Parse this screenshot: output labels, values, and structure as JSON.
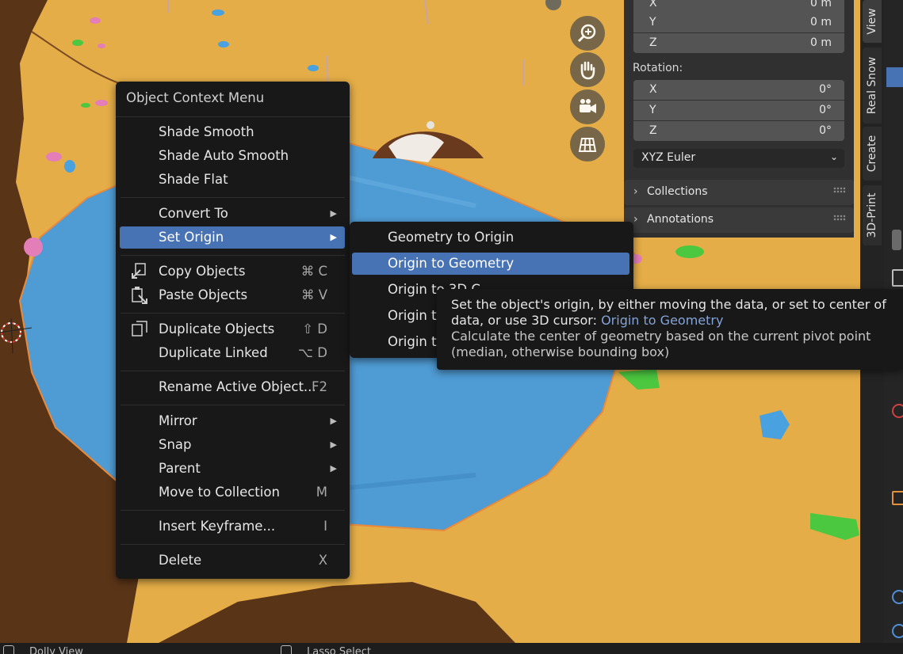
{
  "context_menu": {
    "title": "Object Context Menu",
    "items": [
      {
        "label": "Shade Smooth",
        "shortcut": ""
      },
      {
        "label": "Shade Auto Smooth",
        "shortcut": ""
      },
      {
        "label": "Shade Flat",
        "shortcut": ""
      },
      {
        "label": "Convert To",
        "shortcut": ""
      },
      {
        "label": "Set Origin",
        "shortcut": ""
      },
      {
        "label": "Copy Objects",
        "shortcut": "⌘ C"
      },
      {
        "label": "Paste Objects",
        "shortcut": "⌘ V"
      },
      {
        "label": "Duplicate Objects",
        "shortcut": "⇧ D"
      },
      {
        "label": "Duplicate Linked",
        "shortcut": "⌥ D"
      },
      {
        "label": "Rename Active Object...",
        "shortcut": "F2"
      },
      {
        "label": "Mirror",
        "shortcut": ""
      },
      {
        "label": "Snap",
        "shortcut": ""
      },
      {
        "label": "Parent",
        "shortcut": ""
      },
      {
        "label": "Move to Collection",
        "shortcut": "M"
      },
      {
        "label": "Insert Keyframe...",
        "shortcut": "I"
      },
      {
        "label": "Delete",
        "shortcut": "X"
      }
    ]
  },
  "set_origin_submenu": {
    "items": [
      {
        "label": "Geometry to Origin"
      },
      {
        "label": "Origin to Geometry"
      },
      {
        "label": "Origin to 3D C"
      },
      {
        "label": "Origin to"
      },
      {
        "label": "Origin to"
      }
    ]
  },
  "tooltip": {
    "line1": "Set the object's origin, by either moving the data, or set to center of data, or use 3D cursor:",
    "operator": "Origin to Geometry",
    "line2": "Calculate the center of geometry based on the current pivot point (median, otherwise bounding box)"
  },
  "n_panel": {
    "location": [
      {
        "axis": "X",
        "value": "0 m"
      },
      {
        "axis": "Y",
        "value": "0 m"
      },
      {
        "axis": "Z",
        "value": "0 m"
      }
    ],
    "rotation_label": "Rotation:",
    "rotation": [
      {
        "axis": "X",
        "value": "0°"
      },
      {
        "axis": "Y",
        "value": "0°"
      },
      {
        "axis": "Z",
        "value": "0°"
      }
    ],
    "rotation_mode": "XYZ Euler",
    "collections_label": "Collections",
    "annotations_label": "Annotations"
  },
  "tabs": [
    "View",
    "Real Snow",
    "Create",
    "3D-Print"
  ],
  "status_bar": {
    "left": "Dolly View",
    "middle": "Lasso Select"
  },
  "nav_gizmo": [
    "zoom-icon",
    "hand-pan-icon",
    "camera-icon",
    "ortho-grid-icon"
  ],
  "colors": {
    "highlight": "#4772b3",
    "menu_bg": "#181818",
    "sand": "#e3ac45",
    "water": "#4f9bd4",
    "soil": "#5a3417"
  }
}
